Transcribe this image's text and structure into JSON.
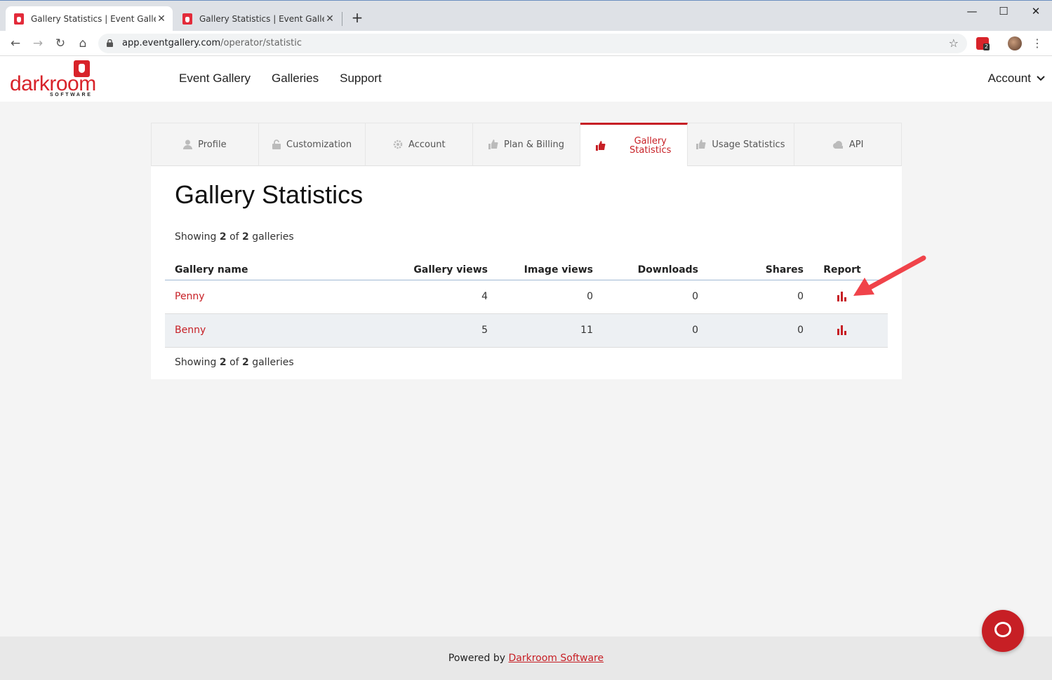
{
  "browser": {
    "tabs": [
      {
        "title": "Gallery Statistics | Event Gallery",
        "active": true
      },
      {
        "title": "Gallery Statistics | Event Gallery",
        "active": false
      }
    ],
    "new_tab_label": "+",
    "url_host": "app.eventgallery.com",
    "url_path": "/operator/statistic",
    "extension_badge": "2",
    "icons": [
      "back-icon",
      "forward-icon",
      "reload-icon",
      "home-icon",
      "lock-icon",
      "star-icon",
      "menu-icon"
    ]
  },
  "header": {
    "logo_text": "darkroom",
    "logo_sub": "SOFTWARE",
    "nav": [
      "Event Gallery",
      "Galleries",
      "Support"
    ],
    "account_label": "Account"
  },
  "tabs": [
    {
      "label": "Profile",
      "icon": "user-icon"
    },
    {
      "label": "Customization",
      "icon": "lock-icon"
    },
    {
      "label": "Account",
      "icon": "gear-icon"
    },
    {
      "label": "Plan & Billing",
      "icon": "thumbs-up-icon"
    },
    {
      "label_line1": "Gallery",
      "label_line2": "Statistics",
      "icon": "thumbs-up-icon",
      "active": true
    },
    {
      "label": "Usage Statistics",
      "icon": "thumbs-up-icon"
    },
    {
      "label": "API",
      "icon": "cloud-icon"
    }
  ],
  "page": {
    "title": "Gallery Statistics",
    "showing_prefix": "Showing",
    "showing_count": "2",
    "showing_of": "of",
    "showing_total": "2",
    "showing_suffix": "galleries"
  },
  "table": {
    "columns": [
      "Gallery name",
      "Gallery views",
      "Image views",
      "Downloads",
      "Shares",
      "Report"
    ],
    "rows": [
      {
        "name": "Penny",
        "gallery_views": "4",
        "image_views": "0",
        "downloads": "0",
        "shares": "0"
      },
      {
        "name": "Benny",
        "gallery_views": "5",
        "image_views": "11",
        "downloads": "0",
        "shares": "0"
      }
    ]
  },
  "footer": {
    "powered_by": "Powered by",
    "link_text": "Darkroom Software"
  },
  "colors": {
    "brand_red": "#c71f25",
    "annotation_arrow": "#f0434a"
  }
}
